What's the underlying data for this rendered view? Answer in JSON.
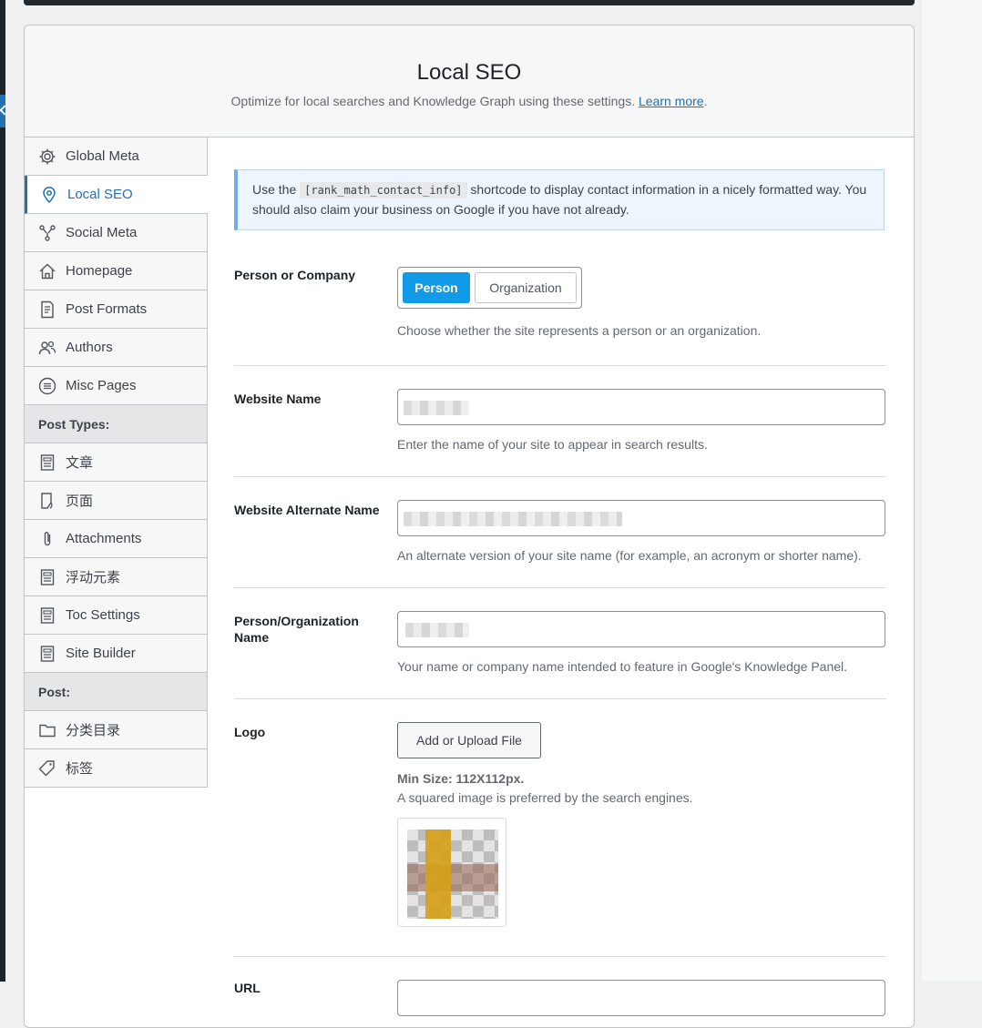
{
  "header": {
    "title": "Local SEO",
    "subtitle": "Optimize for local searches and Knowledge Graph using these settings.",
    "learn_more": "Learn more",
    "period": "."
  },
  "sidebar": {
    "items": [
      {
        "label": "Global Meta",
        "icon": "gear-icon"
      },
      {
        "label": "Local SEO",
        "icon": "location-pin-icon",
        "active": true
      },
      {
        "label": "Social Meta",
        "icon": "network-icon"
      },
      {
        "label": "Homepage",
        "icon": "home-icon"
      },
      {
        "label": "Post Formats",
        "icon": "document-icon"
      },
      {
        "label": "Authors",
        "icon": "users-icon"
      },
      {
        "label": "Misc Pages",
        "icon": "list-circle-icon"
      }
    ],
    "post_types_heading": "Post Types:",
    "post_types": [
      {
        "label": "文章",
        "icon": "post-icon"
      },
      {
        "label": "页面",
        "icon": "page-icon"
      },
      {
        "label": "Attachments",
        "icon": "paperclip-icon"
      },
      {
        "label": "浮动元素",
        "icon": "post-icon"
      },
      {
        "label": "Toc Settings",
        "icon": "post-icon"
      },
      {
        "label": "Site Builder",
        "icon": "post-icon"
      }
    ],
    "post_heading": "Post:",
    "post": [
      {
        "label": "分类目录",
        "icon": "folder-icon"
      },
      {
        "label": "标签",
        "icon": "tag-icon"
      }
    ]
  },
  "notice": {
    "before": "Use the",
    "code": "[rank_math_contact_info]",
    "after": "shortcode to display contact information in a nicely formatted way. You should also claim your business on Google if you have not already."
  },
  "fields": {
    "person_or_company": {
      "label": "Person or Company",
      "options": [
        "Person",
        "Organization"
      ],
      "selected": "Person",
      "description": "Choose whether the site represents a person or an organization."
    },
    "website_name": {
      "label": "Website Name",
      "description": "Enter the name of your site to appear in search results."
    },
    "website_alternate_name": {
      "label": "Website Alternate Name",
      "description": "An alternate version of your site name (for example, an acronym or shorter name)."
    },
    "org_name": {
      "label": "Person/Organization Name",
      "description": "Your name or company name intended to feature in Google's Knowledge Panel."
    },
    "logo": {
      "label": "Logo",
      "button": "Add or Upload File",
      "min_size": "Min Size: 112X112px.",
      "description": "A squared image is preferred by the search engines."
    },
    "url": {
      "label": "URL"
    }
  },
  "colors": {
    "accent": "#2271b1",
    "person_button": "#109ae8"
  }
}
